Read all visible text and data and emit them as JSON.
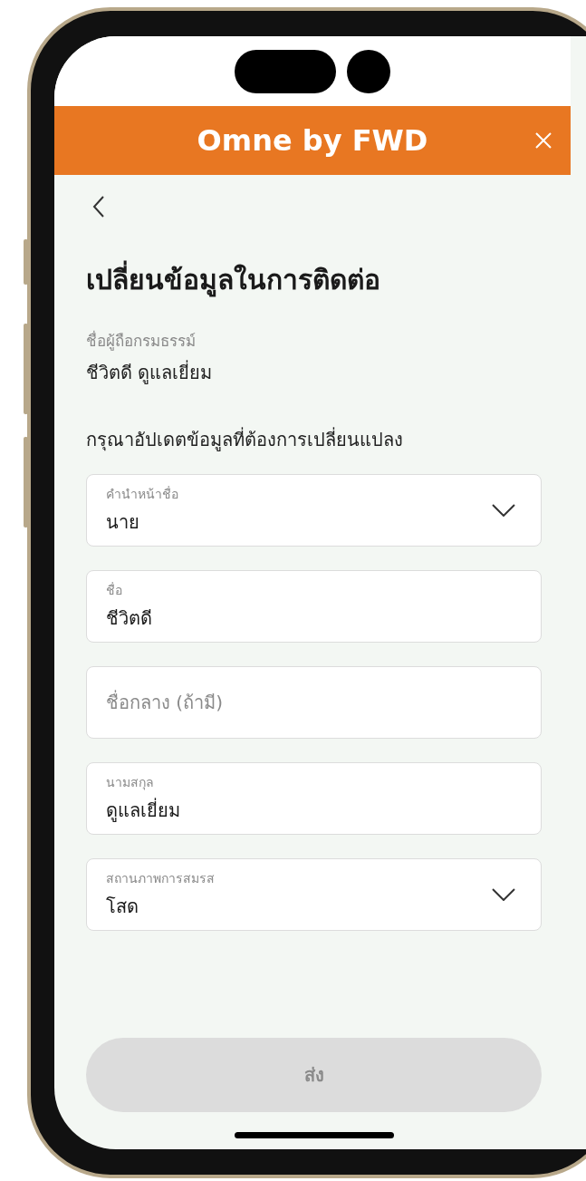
{
  "header": {
    "title": "Omne by FWD"
  },
  "page": {
    "title": "เปลี่ยนข้อมูลในการติดต่อ"
  },
  "holder": {
    "label": "ชื่อผู้ถือกรมธรรม์",
    "value": "ชีวิตดี ดูแลเยี่ยม"
  },
  "instruction": "กรุณาอัปเดตข้อมูลที่ต้องการเปลี่ยนแปลง",
  "fields": [
    {
      "kind": "select",
      "label": "คำนำหน้าชื่อ",
      "value": "นาย"
    },
    {
      "kind": "text",
      "label": "ชื่อ",
      "value": "ชีวิตดี"
    },
    {
      "kind": "text",
      "placeholder": "ชื่อกลาง (ถ้ามี)"
    },
    {
      "kind": "text",
      "label": "นามสกุล",
      "value": "ดูแลเยี่ยม"
    },
    {
      "kind": "select",
      "label": "สถานภาพการสมรส",
      "value": "โสด"
    }
  ],
  "submit": {
    "label": "ส่ง",
    "disabled": true
  }
}
